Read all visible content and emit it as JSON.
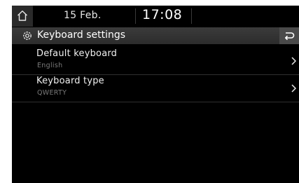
{
  "status": {
    "date": "15 Feb.",
    "time": "17:08"
  },
  "header": {
    "title": "Keyboard settings"
  },
  "settings": [
    {
      "label": "Default keyboard",
      "value": "English"
    },
    {
      "label": "Keyboard type",
      "value": "QWERTY"
    }
  ],
  "icons": {
    "home": "home-icon",
    "settings": "gear-icon",
    "back": "back-arrow-icon",
    "row": "chevron-right-icon"
  },
  "colors": {
    "background": "#000000",
    "titlebar": "#333333",
    "text": "#ffffff",
    "subtext": "#7a7a7a"
  }
}
